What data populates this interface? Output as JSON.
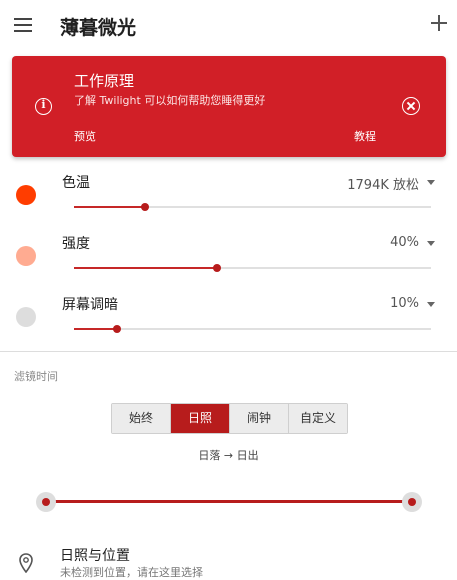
{
  "app_bar": {
    "title": "薄暮微光"
  },
  "info_card": {
    "title": "工作原理",
    "subtitle": "了解 Twilight 可以如何帮助您睡得更好",
    "preview_label": "预览",
    "tutorial_label": "教程",
    "color": "#d11f27"
  },
  "settings": [
    {
      "label": "色温",
      "value": "1794K 放松",
      "level": 0.2,
      "dot_color": "#ff3d00"
    },
    {
      "label": "强度",
      "value": "40%",
      "level": 0.4,
      "dot_color": "#ffab91"
    },
    {
      "label": "屏幕调暗",
      "value": "10%",
      "level": 0.12,
      "dot_color": "#dddddd"
    }
  ],
  "filter_time": {
    "header": "滤镜时间",
    "options": [
      "始终",
      "日照",
      "闹钟",
      "自定义"
    ],
    "selected_index": 1,
    "range_text": "日落 → 日出"
  },
  "location": {
    "title": "日照与位置",
    "subtitle": "未检测到位置，请在这里选择"
  }
}
